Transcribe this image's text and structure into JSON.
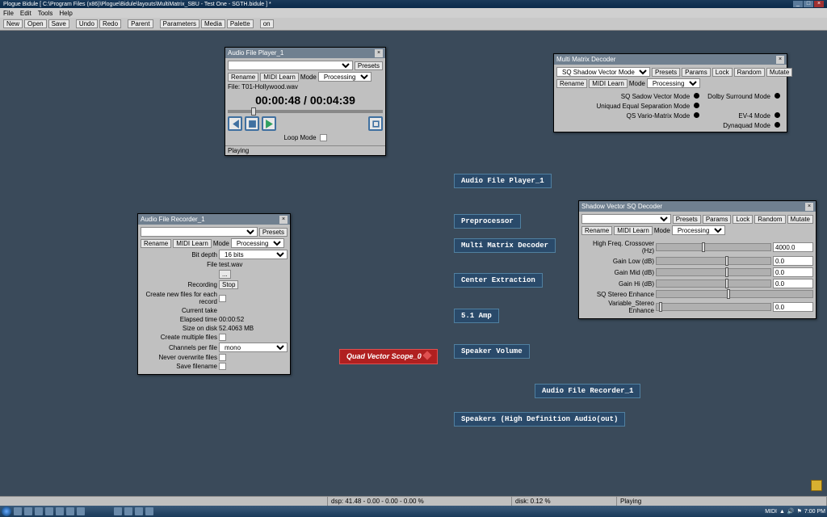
{
  "title": "Plogue Bidule [ C:\\Program Files (x86)\\Plogue\\Bidule\\layouts\\MultiMatrix_SBU - Test One - SGTH.bidule ] *",
  "menu": {
    "file": "File",
    "edit": "Edit",
    "tools": "Tools",
    "help": "Help"
  },
  "tb": {
    "new": "New",
    "open": "Open",
    "save": "Save",
    "undo": "Undo",
    "redo": "Redo",
    "parent": "Parent",
    "parameters": "Parameters",
    "media": "Media",
    "palette": "Palette",
    "on": "on"
  },
  "player": {
    "title": "Audio File Player_1",
    "presets": "Presets",
    "rename": "Rename",
    "midilearn": "MIDI Learn",
    "mode": "Mode",
    "mode_val": "Processing",
    "file_lbl": "File:",
    "file_val": "T01-Hollywood.wav",
    "time": "00:00:48 / 00:04:39",
    "loop": "Loop Mode",
    "status": "Playing"
  },
  "recorder": {
    "title": "Audio File Recorder_1",
    "presets": "Presets",
    "rename": "Rename",
    "midilearn": "MIDI Learn",
    "mode": "Mode",
    "mode_val": "Processing",
    "bitdepth": "Bit depth",
    "bitdepth_val": "16 bits",
    "file": "File",
    "file_val": "test.wav",
    "ellipsis": "...",
    "recording": "Recording",
    "stop": "Stop",
    "newfiles": "Create new files for each record",
    "take": "Current take",
    "elapsed": "Elapsed time",
    "elapsed_val": "00:00:52",
    "size": "Size on disk",
    "size_val": "52.4063 MB",
    "multi": "Create multiple files",
    "chanper": "Channels per file",
    "chanper_val": "mono",
    "overwrite": "Never overwrite files",
    "savename": "Save filename"
  },
  "mmdec": {
    "title": "Multi Matrix Decoder",
    "preset": "SQ Shadow Vector Mode",
    "presets": "Presets",
    "params": "Params",
    "lock": "Lock",
    "random": "Random",
    "mutate": "Mutate",
    "rename": "Rename",
    "midilearn": "MIDI Learn",
    "mode": "Mode",
    "mode_val": "Processing",
    "o1": "SQ Sadow Vector Mode",
    "o2": "Dolby Surround Mode",
    "o3": "Uniquad Equal Separation Mode",
    "o4": "QS Vario-Matrix Mode",
    "o5": "EV-4 Mode",
    "o6": "Dynaquad Mode"
  },
  "svdec": {
    "title": "Shadow Vector SQ Decoder",
    "presets": "Presets",
    "params": "Params",
    "lock": "Lock",
    "random": "Random",
    "mutate": "Mutate",
    "rename": "Rename",
    "midilearn": "MIDI Learn",
    "mode": "Mode",
    "mode_val": "Processing",
    "p1": "High Freq. Crossover (Hz)",
    "v1": "4000.0",
    "p2": "Gain Low (dB)",
    "v2": "0.0",
    "p3": "Gain Mid (dB)",
    "v3": "0.0",
    "p4": "Gain Hi (dB)",
    "v4": "0.0",
    "p5": "SQ Stereo Enhance",
    "p6": "Variable_Stereo Enhance",
    "v6": "0.0"
  },
  "nodes": {
    "n1": "Audio File Player_1",
    "n2": "Preprocessor",
    "n3": "Multi Matrix Decoder",
    "n4": "Center Extraction",
    "n5": "5.1 Amp",
    "n6": "Quad Vector Scope_0",
    "n7": "Speaker Volume",
    "n8": "Audio File Recorder_1",
    "n9": "Speakers (High Definition Audio(out)"
  },
  "status": {
    "dsp": "dsp: 41.48 - 0.00 - 0.00 - 0.00 %",
    "disk": "disk: 0.12 %",
    "playing": "Playing"
  },
  "tray": {
    "midi": "MIDI",
    "time": "7:00 PM"
  }
}
